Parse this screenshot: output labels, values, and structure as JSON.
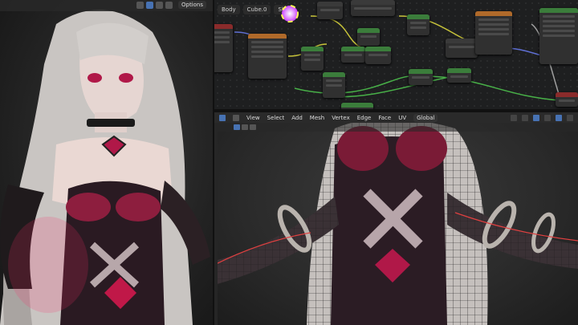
{
  "left_viewport": {
    "header": {
      "mode": "Options"
    }
  },
  "node_editor": {
    "header": {
      "object": "Body",
      "material": "Cube.0",
      "slot": "Slot"
    }
  },
  "edit_viewport": {
    "menu": [
      "View",
      "Select",
      "Add",
      "Mesh",
      "Vertex",
      "Edge",
      "Face",
      "UV"
    ],
    "orientation": "Global"
  },
  "colors": {
    "accent": "#4772b3",
    "node_green": "#3b7d3b",
    "node_orange": "#b06a2a",
    "node_red": "#8a2b2b",
    "node_blue": "#3a5a8a",
    "link_yellow": "#c8c43a",
    "link_green": "#48b048",
    "link_gray": "#a0a0a0",
    "link_blue": "#5f6fd3"
  }
}
